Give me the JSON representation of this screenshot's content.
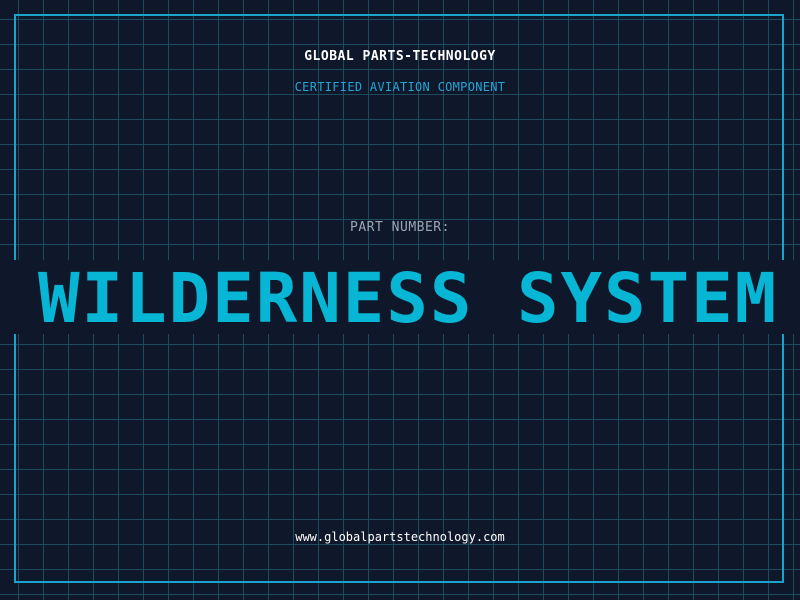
{
  "header": {
    "company": "GLOBAL PARTS-TECHNOLOGY",
    "subtitle": "CERTIFIED AVIATION COMPONENT"
  },
  "part": {
    "label": "PART NUMBER:",
    "value": "WILDERNESS SYSTEM"
  },
  "footer": {
    "url": "www.globalpartstechnology.com"
  },
  "colors": {
    "background": "#0f172a",
    "grid": "#1e4a5e",
    "accent": "#06b6d4",
    "frame": "#1aa3cc",
    "label": "#9aa7b6",
    "text": "#ffffff"
  }
}
